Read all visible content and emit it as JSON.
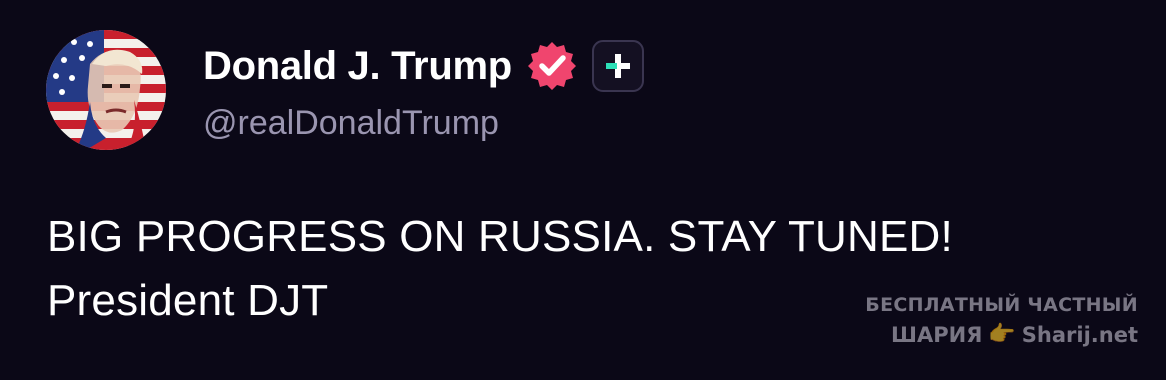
{
  "profile": {
    "display_name": "Donald J. Trump",
    "handle": "@realDonaldTrump",
    "avatar": "flag-portrait-avatar",
    "verified_icon": "verified-badge-icon",
    "follow_icon": "plus-icon"
  },
  "post": {
    "lines": [
      "BIG PROGRESS ON RUSSIA. STAY TUNED!",
      "President DJT"
    ]
  },
  "watermark": {
    "line1": "БЕСПЛАТНЫЙ ЧАСТНЫЙ",
    "line2_left": "ШАРИЯ",
    "hand_icon": "👉",
    "line2_right": "Sharij.net"
  },
  "colors": {
    "background": "#0b0817",
    "text": "#ffffff",
    "handle": "#9a95b0",
    "verified": "#f0456e",
    "follow_accent": "#2de0b8",
    "follow_border": "#3a3550"
  }
}
